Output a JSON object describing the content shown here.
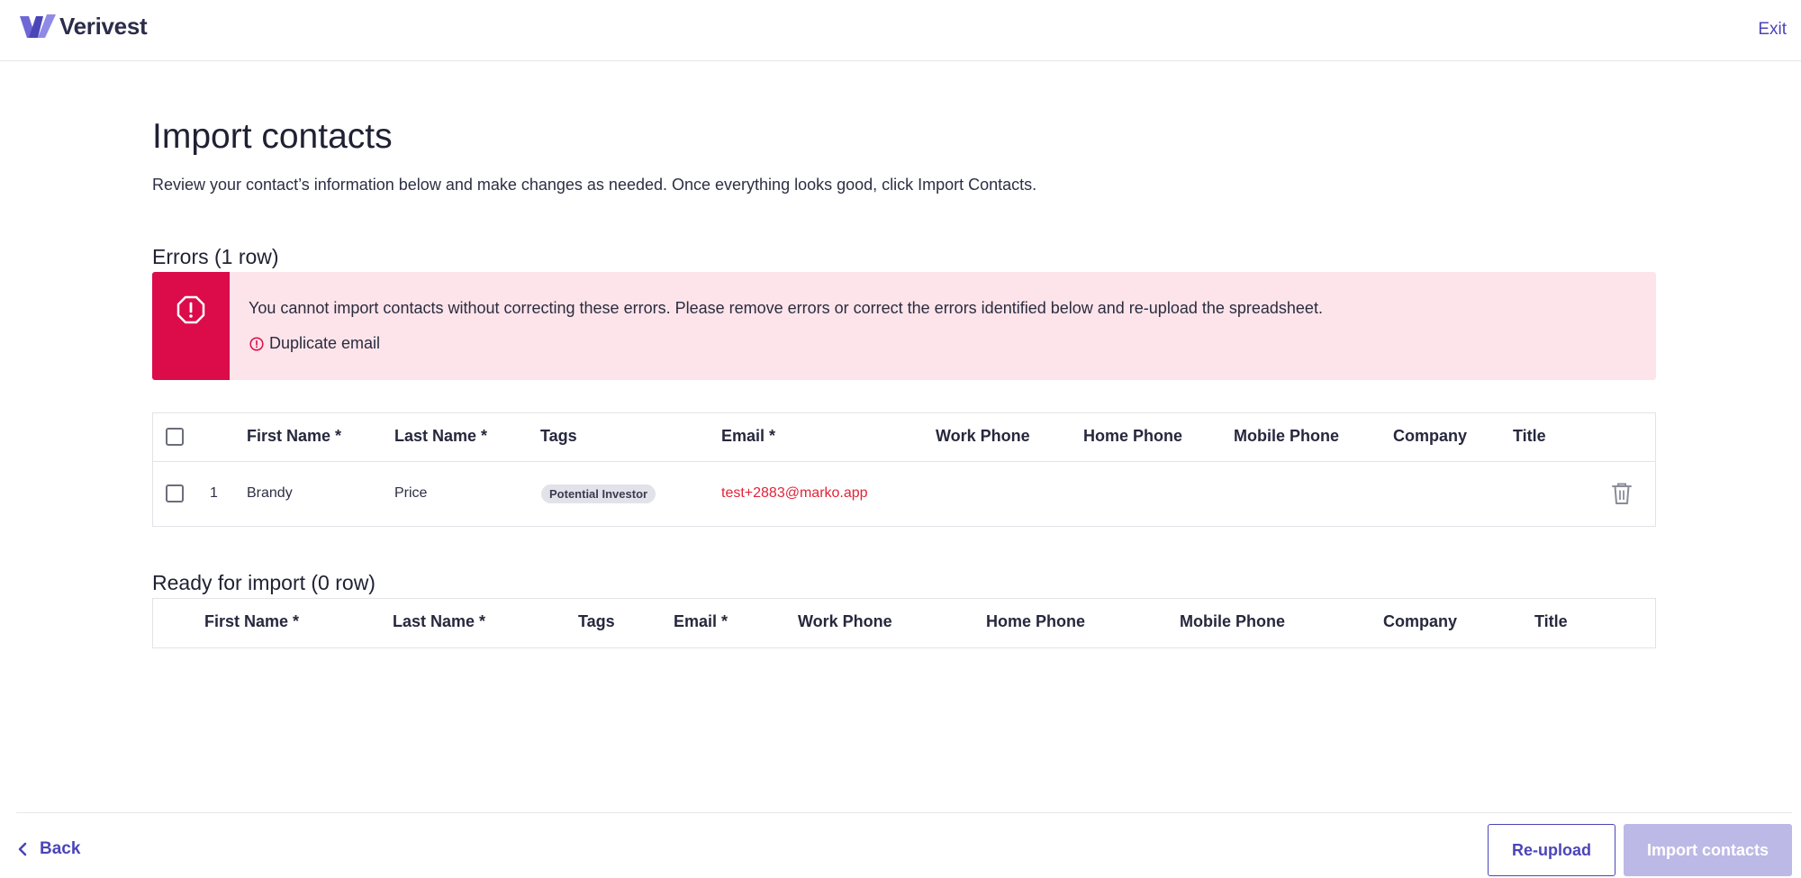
{
  "app": {
    "brand_name": "Verivest",
    "exit_label": "Exit",
    "accent_color": "#4b45b8"
  },
  "page": {
    "title": "Import contacts",
    "description": "Review your contact’s information below and make changes as needed. Once everything looks good, click Import Contacts."
  },
  "errors": {
    "section_title": "Errors (1 row)",
    "banner_message": "You cannot import contacts without correcting these errors. Please remove errors or correct the errors identified below and re-upload the spreadsheet.",
    "error_items": [
      "Duplicate email"
    ],
    "banner_color": "#dc0b4a",
    "columns": [
      "First Name *",
      "Last Name *",
      "Tags",
      "Email *",
      "Work Phone",
      "Home Phone",
      "Mobile Phone",
      "Company",
      "Title"
    ],
    "rows": [
      {
        "index": "1",
        "first_name": "Brandy",
        "last_name": "Price",
        "tag": "Potential Investor",
        "email": "test+2883@marko.app",
        "work_phone": "",
        "home_phone": "",
        "mobile_phone": "",
        "company": "",
        "title": ""
      }
    ]
  },
  "ready": {
    "section_title": "Ready for import (0 row)",
    "columns": [
      "First Name *",
      "Last Name *",
      "Tags",
      "Email *",
      "Work Phone",
      "Home Phone",
      "Mobile Phone",
      "Company",
      "Title"
    ]
  },
  "footer": {
    "back_label": "Back",
    "reupload_label": "Re-upload",
    "import_label": "Import contacts"
  },
  "icons": {
    "logo": "verivest-logo-icon",
    "banner": "alert-octagon-icon",
    "error_item": "alert-circle-icon",
    "delete": "trash-icon",
    "back": "chevron-left-icon"
  }
}
